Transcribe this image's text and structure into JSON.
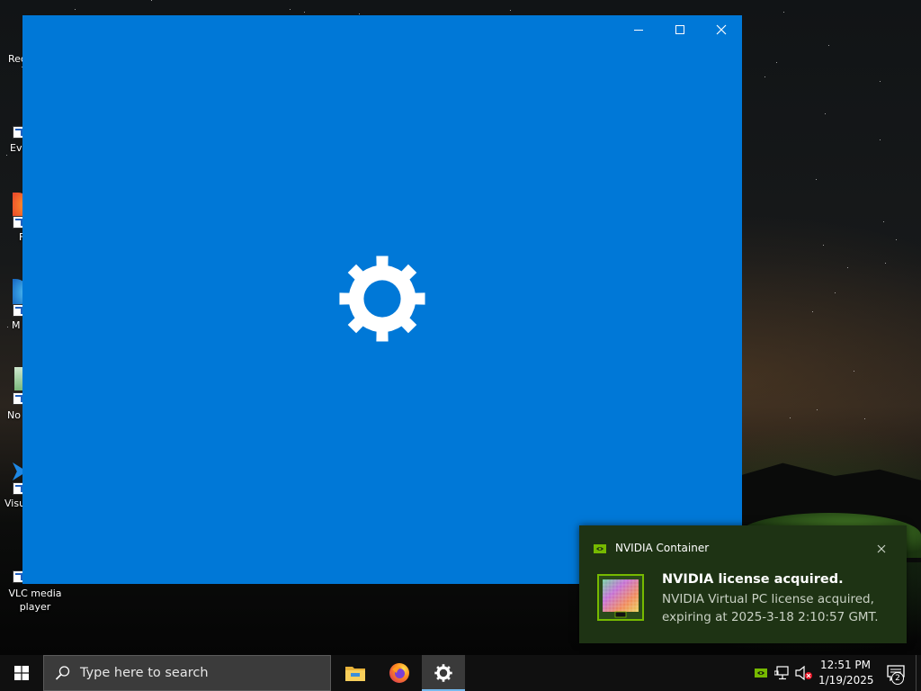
{
  "desktop": {
    "icons": [
      {
        "label": "Rec"
      },
      {
        "label": "Ev"
      },
      {
        "label": "F"
      },
      {
        "label": "M"
      },
      {
        "label": "No"
      },
      {
        "label": "Visu"
      },
      {
        "label": "VLC media player"
      }
    ]
  },
  "window": {
    "background": "#0078d7",
    "splash_icon": "gear-icon",
    "controls": {
      "minimize": "minimize-icon",
      "maximize": "maximize-icon",
      "close": "close-icon"
    }
  },
  "notification": {
    "app_name": "NVIDIA Container",
    "title": "NVIDIA license acquired.",
    "body": "NVIDIA Virtual PC license acquired, expiring at 2025-3-18 2:10:57 GMT.",
    "background": "#1e3314",
    "accent": "#76b900"
  },
  "taskbar": {
    "search_placeholder": "Type here to search",
    "pinned": [
      "file-explorer-icon",
      "firefox-icon",
      "settings-icon"
    ],
    "active_app": "settings-icon",
    "clock": {
      "time": "12:51 PM",
      "date": "1/19/2025"
    },
    "notification_count": "2"
  }
}
